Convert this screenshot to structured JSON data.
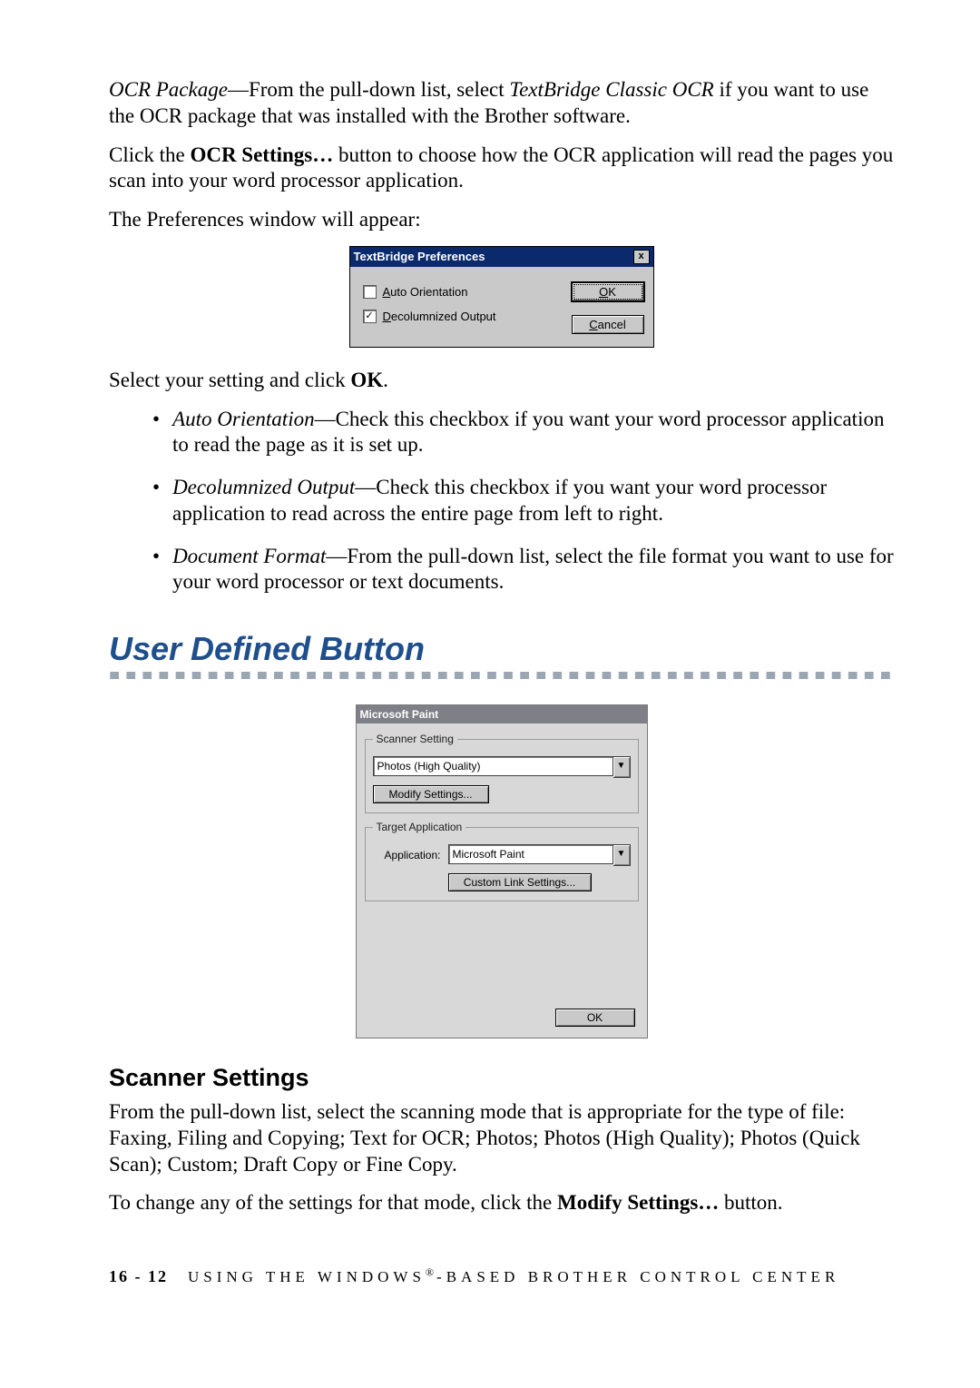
{
  "para1_pre": "OCR Package",
  "para1_mid": "—From the pull-down list, select ",
  "para1_em": "TextBridge Classic OCR",
  "para1_post": " if you want to use the OCR package that was installed with the Brother software.",
  "para2_pre": "Click the ",
  "para2_bold": "OCR Settings…",
  "para2_post": " button to choose how the OCR application will read the pages you scan into your word processor application.",
  "para3": "The Preferences window will appear:",
  "dlg1": {
    "title": "TextBridge Preferences",
    "close": "x",
    "auto_u": "A",
    "auto_rest": "uto Orientation",
    "decol_u": "D",
    "decol_rest": "ecolumnized Output",
    "ok_u": "O",
    "ok_rest": "K",
    "cancel_u": "C",
    "cancel_rest": "ancel",
    "check_mark": "✓"
  },
  "para4_pre": "Select your setting and click ",
  "para4_bold": "OK",
  "para4_post": ".",
  "bullets": {
    "b1_em": "Auto Orientation",
    "b1_rest": "—Check this checkbox if you want your word processor application to read the page as it is set up.",
    "b2_em": "Decolumnized Output",
    "b2_rest": "—Check this checkbox if you want your word processor application to read across the entire page from left to right.",
    "b3_em": "Document Format",
    "b3_rest": "—From the pull-down list, select the file format you want to use for your word processor or text documents."
  },
  "h1": "User Defined Button",
  "dlg2": {
    "title": "Microsoft Paint",
    "group1": "Scanner Setting",
    "combo1": "Photos (High Quality)",
    "arrow": "▼",
    "modify": "Modify Settings...",
    "group2": "Target Application",
    "app_label": "Application:",
    "combo2": "Microsoft Paint",
    "custom": "Custom Link Settings...",
    "ok": "OK"
  },
  "h2": "Scanner Settings",
  "para5": "From the pull-down list, select the scanning mode that is appropriate for the type of file: Faxing, Filing and Copying; Text for OCR; Photos; Photos (High Quality); Photos (Quick Scan); Custom; Draft Copy or Fine Copy.",
  "para6_pre": "To change any of the settings for that mode, click the ",
  "para6_bold": "Modify Settings…",
  "para6_post": " button.",
  "footer_page": "16 - 12",
  "footer_a": "USING THE WINDOWS",
  "footer_r": "®",
  "footer_b": "-BASED BROTHER CONTROL CENTER"
}
